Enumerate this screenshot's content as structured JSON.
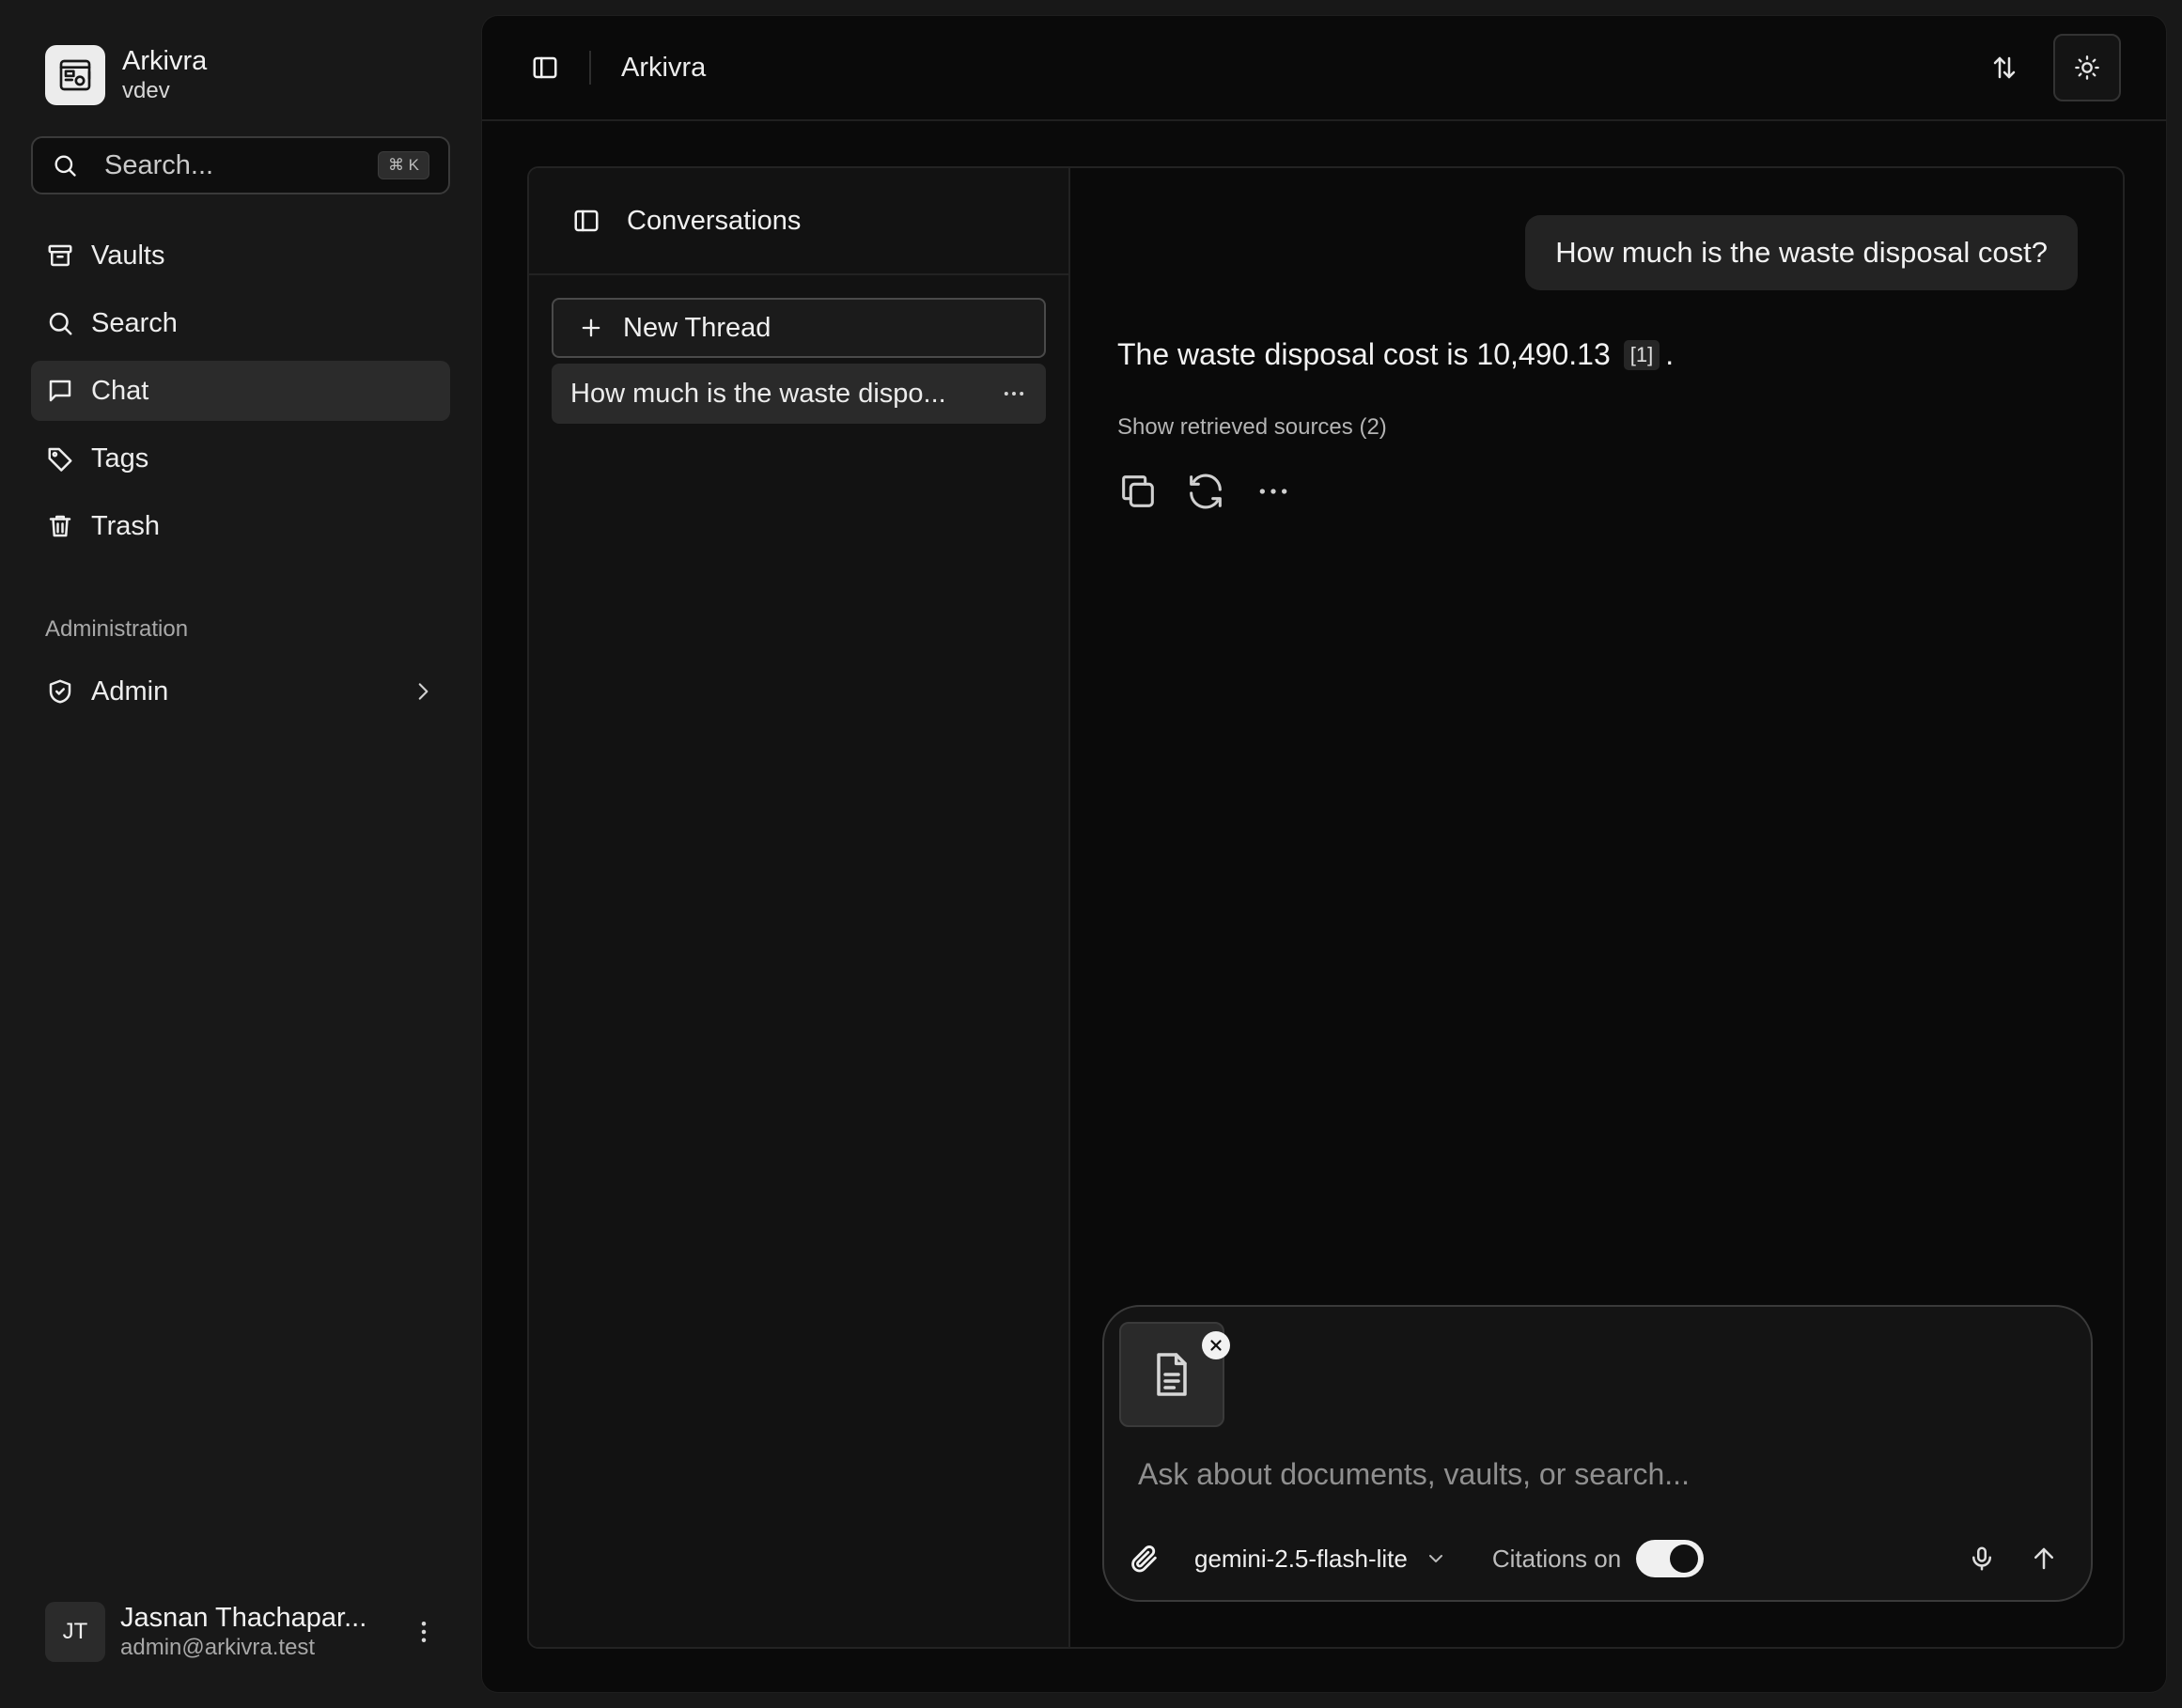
{
  "brand": {
    "name": "Arkivra",
    "workspace": "vdev"
  },
  "search": {
    "placeholder": "Search...",
    "shortcut": "⌘ K"
  },
  "nav": {
    "items": [
      {
        "label": "Vaults",
        "icon": "archive-icon",
        "active": false
      },
      {
        "label": "Search",
        "icon": "search-icon",
        "active": false
      },
      {
        "label": "Chat",
        "icon": "chat-bubble-icon",
        "active": true
      },
      {
        "label": "Tags",
        "icon": "tag-icon",
        "active": false
      },
      {
        "label": "Trash",
        "icon": "trash-icon",
        "active": false
      }
    ],
    "section_label": "Administration",
    "admin_label": "Admin"
  },
  "user": {
    "initials": "JT",
    "name": "Jasnan Thachapar...",
    "email": "admin@arkivra.test"
  },
  "topbar": {
    "title": "Arkivra"
  },
  "conversations": {
    "title": "Conversations",
    "new_thread_label": "New Thread",
    "threads": [
      {
        "title": "How much is the waste dispo..."
      }
    ]
  },
  "chat": {
    "user_message": "How much is the waste disposal cost?",
    "answer_text": "The waste disposal cost is 10,490.13",
    "citation": "[1]",
    "answer_end": ".",
    "sources_label": "Show retrieved sources (2)"
  },
  "composer": {
    "placeholder": "Ask about documents, vaults, or search...",
    "model": "gemini-2.5-flash-lite",
    "citations_label": "Citations on",
    "citations_enabled": true
  }
}
